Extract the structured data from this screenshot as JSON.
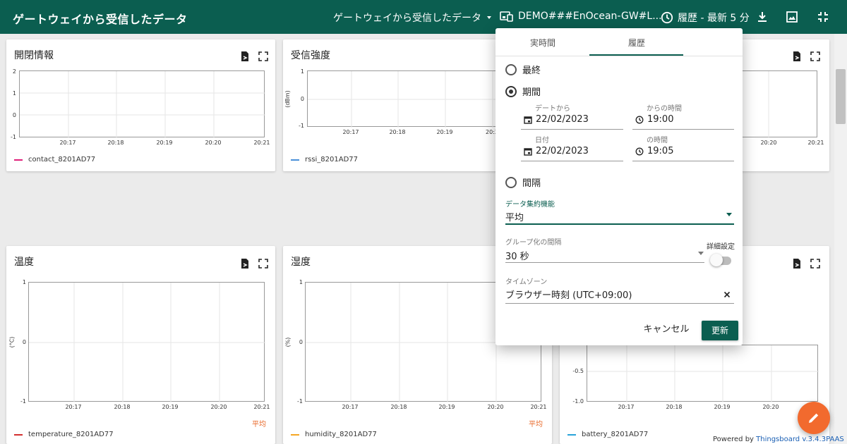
{
  "header": {
    "title": "ゲートウェイから受信したデータ",
    "state_selector": "ゲートウェイから受信したデータ",
    "entity": "DEMO###EnOcean-GW#L...",
    "timewindow": "履歴 - 最新 5 分"
  },
  "widgets": [
    {
      "title": "開閉情報",
      "yticks": [
        "2",
        "1",
        "0",
        "-1"
      ],
      "yunit": "",
      "xticks": [
        "20:17",
        "20:18",
        "20:19",
        "20:20",
        "20:21"
      ],
      "legend": "contact_8201AD77",
      "legend_color": "#e0207a",
      "agg": ""
    },
    {
      "title": "受信強度",
      "yticks": [
        "1",
        "0",
        "-1"
      ],
      "yunit": "(dBm)",
      "xticks": [
        "20:17",
        "20:18",
        "20:19",
        "20:2"
      ],
      "legend": "rssi_8201AD77",
      "legend_color": "#4a90d9",
      "agg": ""
    },
    {
      "title": "",
      "yticks": [],
      "yunit": "",
      "xticks": [
        "20:20",
        "20:21"
      ],
      "legend": "",
      "legend_color": "",
      "agg": ""
    },
    {
      "title": "温度",
      "yticks": [
        "1",
        "0",
        "-1"
      ],
      "yunit": "(°C)",
      "xticks": [
        "20:17",
        "20:18",
        "20:19",
        "20:20",
        "20:21"
      ],
      "legend": "temperature_8201AD77",
      "legend_color": "#d32f2f",
      "agg": "平均"
    },
    {
      "title": "湿度",
      "yticks": [
        "1",
        "0",
        "-1"
      ],
      "yunit": "(%)",
      "xticks": [
        "20:17",
        "20:18",
        "20:19",
        "20:20",
        "20:21"
      ],
      "legend": "humidity_8201AD77",
      "legend_color": "#f5a623",
      "agg": "平均"
    },
    {
      "title": "",
      "yticks": [
        "-0.5",
        "-1.0"
      ],
      "yunit": "",
      "xticks": [
        "20:17",
        "20:18",
        "20:19",
        "20:20"
      ],
      "legend": "battery_8201AD77",
      "legend_color": "#29a3d9",
      "agg": ""
    }
  ],
  "popup": {
    "tab_realtime": "実時間",
    "tab_history": "履歴",
    "opt_last": "最終",
    "opt_range": "期間",
    "from_date_label": "デートから",
    "from_date": "22/02/2023",
    "from_time_label": "からの時間",
    "from_time": "19:00",
    "to_date_label": "日付",
    "to_date": "22/02/2023",
    "to_time_label": "の時間",
    "to_time": "19:05",
    "opt_interval": "間隔",
    "agg_label": "データ集約機能",
    "agg_value": "平均",
    "group_label": "グループ化の間隔",
    "group_value": "30 秒",
    "advanced_label": "詳細設定",
    "tz_label": "タイムゾーン",
    "tz_value": "ブラウザー時刻 (UTC+09:00)",
    "cancel": "キャンセル",
    "update": "更新"
  },
  "footer": {
    "powered_prefix": "Powered by ",
    "powered_link": "Thingsboard v.3.4.3PAAS"
  }
}
